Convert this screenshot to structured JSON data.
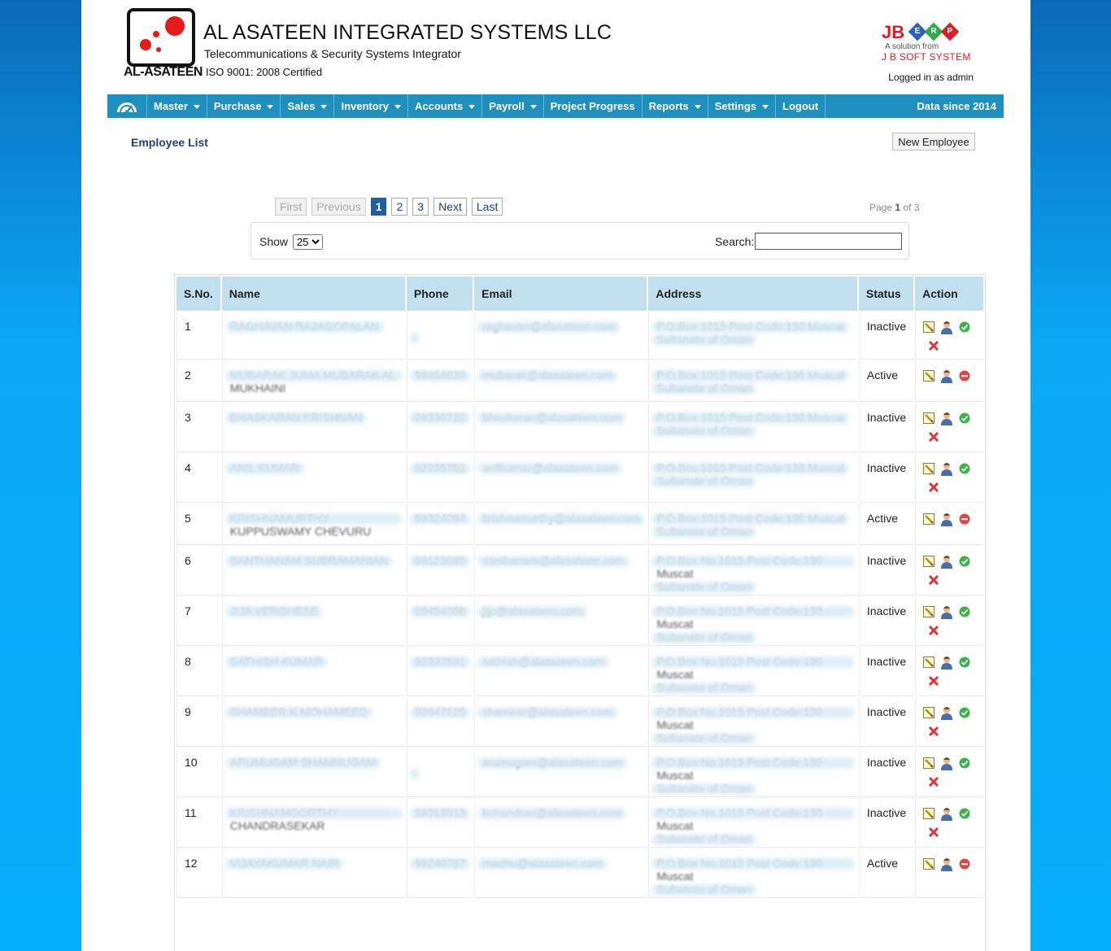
{
  "header": {
    "logo_caption": "AL-ASATEEN",
    "company_name": "AL ASATEEN INTEGRATED SYSTEMS LLC",
    "company_subtitle": "Telecommunications & Security Systems Integrator",
    "iso_text": "ISO 9001: 2008 Certified",
    "erp_brand": "JB",
    "erp_letters": [
      "E",
      "R",
      "P"
    ],
    "erp_tagline": "A solution from",
    "erp_vendor": "J B SOFT SYSTEM",
    "logged_in": "Logged in as admin"
  },
  "nav": {
    "items": [
      "Master",
      "Purchase",
      "Sales",
      "Inventory",
      "Accounts",
      "Payroll",
      "Project Progress",
      "Reports",
      "Settings",
      "Logout"
    ],
    "data_since": "Data since 2014"
  },
  "page": {
    "title": "Employee List",
    "new_button": "New Employee"
  },
  "pager": {
    "first": "First",
    "previous": "Previous",
    "pages": [
      "1",
      "2",
      "3"
    ],
    "current": "1",
    "next": "Next",
    "last": "Last",
    "page_label": "Page",
    "page_current": "1",
    "page_of": "of 3"
  },
  "filter": {
    "show_label": "Show",
    "show_value": "25",
    "search_label": "Search:",
    "search_value": ""
  },
  "table": {
    "headers": [
      "S.No.",
      "Name",
      "Phone",
      "Email",
      "Address",
      "Status",
      "Action"
    ],
    "rows": [
      {
        "sno": "1",
        "name": "RAGHAVAN RAJAGOPALAN",
        "phone": "",
        "email": "raghavan@alasateen.com",
        "addr1": "P.O.Box 1015 Post Code:130 Muscat",
        "addr2": "Sultanate of Oman",
        "status": "Inactive"
      },
      {
        "sno": "2",
        "name": "MUBARAK JUMA MUBARAK AL MUKHAINI",
        "phone": "99454020",
        "email": "mubarak@alasateen.com",
        "addr1": "P.O.Box 1015 Post Code:130 Muscat",
        "addr2": "Sultanate of Oman",
        "status": "Active"
      },
      {
        "sno": "3",
        "name": "BHASKARAN KRISHNAN",
        "phone": "99330722",
        "email": "bhaskaran@alasateen.com",
        "addr1": "P.O.Box 1015 Post Code:130 Muscat",
        "addr2": "Sultanate of Oman",
        "status": "Inactive"
      },
      {
        "sno": "4",
        "name": "ANIL KUMAR",
        "phone": "92235752",
        "email": "anilkumar@alasateen.com",
        "addr1": "P.O.Box 1015 Post Code:130 Muscat",
        "addr2": "Sultanate of Oman",
        "status": "Inactive"
      },
      {
        "sno": "5",
        "name": "KRISHNAMURTHY KUPPUSWAMY CHEVURU",
        "phone": "99324094",
        "email": "krishnamurthy@alasateen.com",
        "addr1": "P.O.Box 1015 Post Code:130 Muscat",
        "addr2": "Sultanate of Oman",
        "status": "Active"
      },
      {
        "sno": "6",
        "name": "SANTHANAM SUBRAMANIAN",
        "phone": "99123085",
        "email": "santhanam@alasateen.com",
        "addr1": "P.O.Box No.1015 Post Code:130 Muscat",
        "addr2": "Sultanate of Oman",
        "status": "Inactive"
      },
      {
        "sno": "7",
        "name": "JIJA VERGHESE",
        "phone": "99454086",
        "email": "jijo@alasateen.com",
        "addr1": "P.O.Box No.1015 Post Code:130 Muscat",
        "addr2": "Sultanate of Oman",
        "status": "Inactive"
      },
      {
        "sno": "8",
        "name": "SATHISH KUMAR",
        "phone": "92337591",
        "email": "sathish@alasateen.com",
        "addr1": "P.O.Box No.1015 Post Code:130 Muscat",
        "addr2": "Sultanate of Oman",
        "status": "Inactive"
      },
      {
        "sno": "9",
        "name": "SHAMEER K MOHAMEED",
        "phone": "92047125",
        "email": "shameer@alasateen.com",
        "addr1": "P.O.Box No.1015 Post Code:130 Muscat",
        "addr2": "Sultanate of Oman",
        "status": "Inactive"
      },
      {
        "sno": "10",
        "name": "ARUMUGAM SHANMUGAM",
        "phone": "",
        "email": "arumugam@alasateen.com",
        "addr1": "P.O.Box No.1015 Post Code:130 Muscat",
        "addr2": "Sultanate of Oman",
        "status": "Inactive"
      },
      {
        "sno": "11",
        "name": "KRISHNAMOORTHY CHANDRASEKAR",
        "phone": "99313913",
        "email": "kchandran@alasateen.com",
        "addr1": "P.O.Box No.1015 Post Code:130 Muscat",
        "addr2": "Sultanate of Oman",
        "status": "Inactive"
      },
      {
        "sno": "12",
        "name": "VIJAYAKUMAR NAIR",
        "phone": "99240757",
        "email": "madhu@alasateen.com",
        "addr1": "P.O.Box No.1015 Post Code:130 Muscat",
        "addr2": "Sultanate of Oman",
        "status": "Active"
      }
    ]
  },
  "icons": {
    "edit": "edit-icon",
    "user": "user-icon",
    "activate": "activate-icon",
    "deactivate": "deactivate-icon",
    "delete": "delete-icon"
  },
  "colors": {
    "nav_bg": "#1f8fbf",
    "header_row_bg": "#c2dff0",
    "brand_red": "#e31b1b",
    "title_blue": "#1f3f7f"
  }
}
